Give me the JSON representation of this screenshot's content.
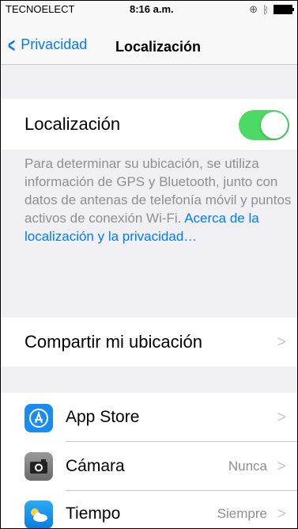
{
  "status_bar": {
    "carrier": "TECNOELECT",
    "time": "8:16 a.m."
  },
  "nav": {
    "back_label": "Privacidad",
    "title": "Localización"
  },
  "location_toggle": {
    "label": "Localización",
    "state": "on",
    "color": "#4cd964"
  },
  "description": {
    "text": "Para determinar su ubicación, se utiliza información de GPS y Bluetooth, junto con datos de antenas de telefonía móvil y puntos activos de conexión Wi-Fi.",
    "link_text": "Acerca de la localización y la privacidad…"
  },
  "share_location": {
    "label": "Compartir mi ubicación"
  },
  "apps": [
    {
      "name": "App Store",
      "value": "",
      "icon": "app-store-icon",
      "color": "#1a8cf0"
    },
    {
      "name": "Cámara",
      "value": "Nunca",
      "icon": "camera-icon",
      "color": "#7a7a7a"
    },
    {
      "name": "Tiempo",
      "value": "Siempre",
      "icon": "weather-icon",
      "color": "#1a9cf0"
    }
  ],
  "colors": {
    "accent": "#007aff",
    "background": "#efeff4"
  }
}
